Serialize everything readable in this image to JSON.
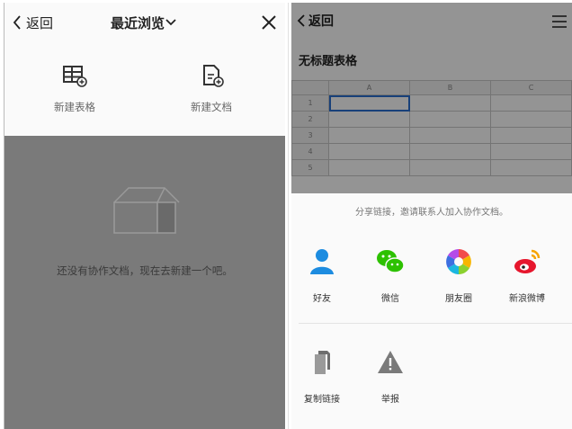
{
  "left": {
    "back_label": "返回",
    "title": "最近浏览",
    "actions": [
      {
        "label": "新建表格",
        "icon": "table-icon"
      },
      {
        "label": "新建文档",
        "icon": "document-icon"
      }
    ],
    "empty_text": "还没有协作文档，现在去新建一个吧。"
  },
  "right": {
    "back_label": "返回",
    "doc_title": "无标题表格",
    "sheet": {
      "columns": [
        "A",
        "B",
        "C"
      ],
      "rows": [
        "1",
        "2",
        "3",
        "4",
        "5"
      ]
    },
    "share_hint": "分享链接，邀请联系人加入协作文档。",
    "share_items": [
      {
        "label": "好友",
        "icon": "contact-icon"
      },
      {
        "label": "微信",
        "icon": "wechat-icon"
      },
      {
        "label": "朋友圈",
        "icon": "moments-icon"
      },
      {
        "label": "新浪微博",
        "icon": "weibo-icon"
      }
    ],
    "more_items": [
      {
        "label": "复制链接",
        "icon": "copy-link-icon"
      },
      {
        "label": "举报",
        "icon": "report-icon"
      }
    ]
  },
  "colors": {
    "dim_overlay": "#7a7a7a",
    "selection_blue": "#2a6fd1",
    "wechat_green": "#2dc100",
    "weibo_red": "#e6162d",
    "contact_blue": "#1d8ce0"
  }
}
